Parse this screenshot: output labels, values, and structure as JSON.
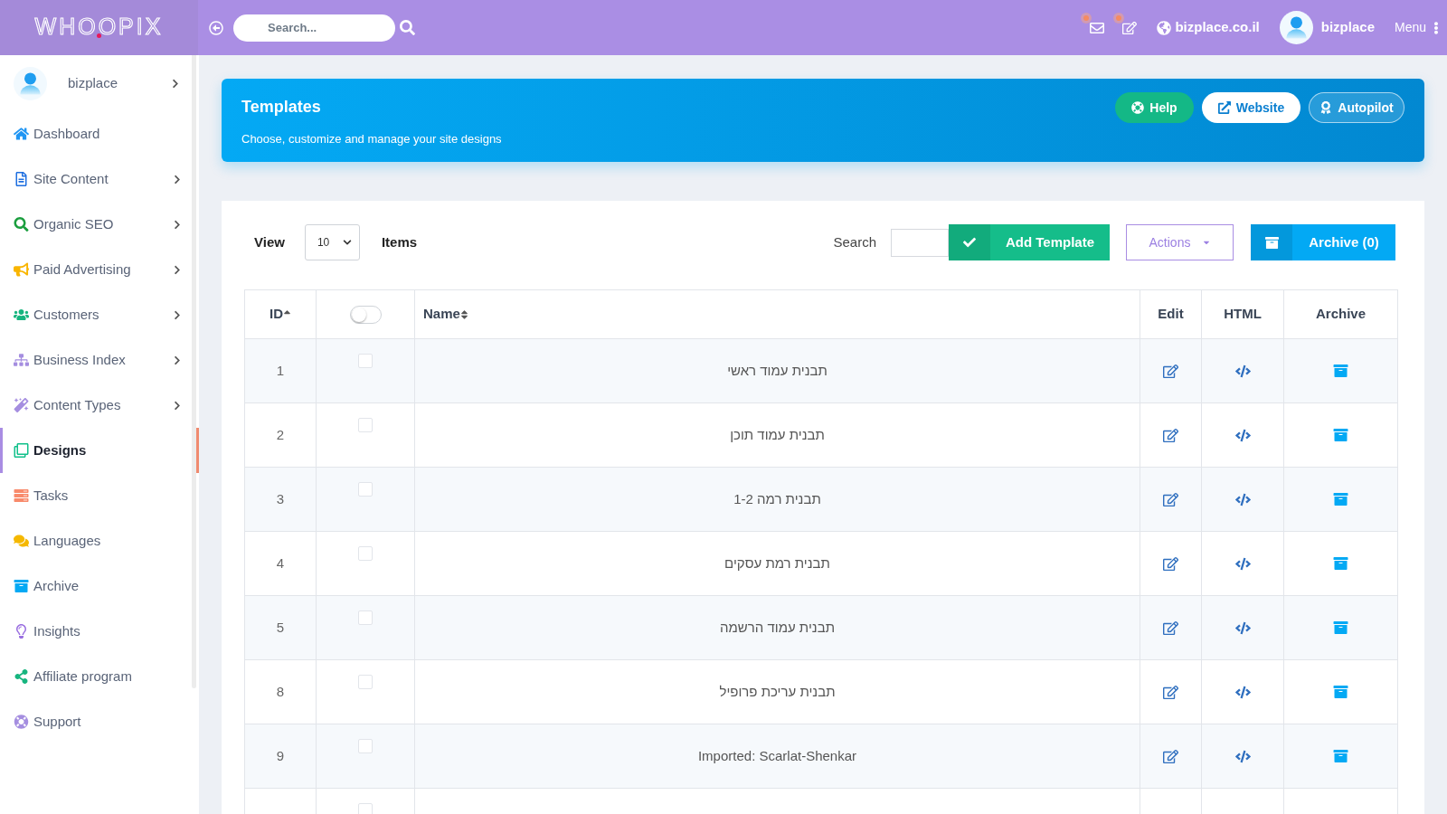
{
  "topbar": {
    "logo": "WHOOPIX",
    "search": {
      "placeholder": "Search..."
    },
    "notifications": [
      {
        "kind": "mail",
        "unread": true
      },
      {
        "kind": "edit",
        "unread": true
      }
    ],
    "site_link": "bizplace.co.il",
    "user": "bizplace",
    "menu": "Menu"
  },
  "sidebar": {
    "user": "bizplace",
    "items": [
      {
        "label": "Dashboard",
        "submenu": false,
        "selected": false
      },
      {
        "label": "Site Content",
        "submenu": true,
        "selected": false
      },
      {
        "label": "Organic SEO",
        "submenu": true,
        "selected": false
      },
      {
        "label": "Paid Advertising",
        "submenu": true,
        "selected": false
      },
      {
        "label": "Customers",
        "submenu": true,
        "selected": false
      },
      {
        "label": "Business Index",
        "submenu": true,
        "selected": false
      },
      {
        "label": "Content Types",
        "submenu": true,
        "selected": false
      },
      {
        "label": "Designs",
        "submenu": false,
        "selected": true
      },
      {
        "label": "Tasks",
        "submenu": false,
        "selected": false
      },
      {
        "label": "Languages",
        "submenu": false,
        "selected": false
      },
      {
        "label": "Archive",
        "submenu": false,
        "selected": false
      },
      {
        "label": "Insights",
        "submenu": false,
        "selected": false
      },
      {
        "label": "Affiliate program",
        "submenu": false,
        "selected": false
      },
      {
        "label": "Support",
        "submenu": false,
        "selected": false
      }
    ]
  },
  "header": {
    "title": "Templates",
    "subtitle": "Choose, customize and manage your site designs",
    "buttons": [
      {
        "kind": "help",
        "label": "Help"
      },
      {
        "kind": "website",
        "label": "Website"
      },
      {
        "kind": "autopilot",
        "label": "Autopilot"
      }
    ]
  },
  "toolbar": {
    "view_label": "View",
    "page_size": "10",
    "items_label": "Items",
    "search_label": "Search",
    "add_button": "Add Template",
    "actions_button": "Actions",
    "archive_button": "Archive (0)"
  },
  "table": {
    "columns": [
      {
        "kind": "text",
        "label": "ID",
        "sortable": true,
        "sorted": true
      },
      {
        "kind": "toggle",
        "on": false
      },
      {
        "kind": "text",
        "label": "Name",
        "sortable": true,
        "sorted": false
      },
      {
        "kind": "text",
        "label": "Edit",
        "sortable": false
      },
      {
        "kind": "text",
        "label": "HTML",
        "sortable": false
      },
      {
        "kind": "text",
        "label": "Archive",
        "sortable": false
      }
    ],
    "rows": [
      {
        "id": "1",
        "checked": false,
        "name": "תבנית עמוד ראשי"
      },
      {
        "id": "2",
        "checked": false,
        "name": "תבנית עמוד תוכן"
      },
      {
        "id": "3",
        "checked": false,
        "name": "תבנית רמה 1-2"
      },
      {
        "id": "4",
        "checked": false,
        "name": "תבנית רמת עסקים"
      },
      {
        "id": "5",
        "checked": false,
        "name": "תבנית עמוד הרשמה"
      },
      {
        "id": "8",
        "checked": false,
        "name": "תבנית עריכת פרופיל"
      },
      {
        "id": "9",
        "checked": false,
        "name": "Imported: Scarlat-Shenkar"
      },
      {
        "checked": false
      }
    ]
  }
}
